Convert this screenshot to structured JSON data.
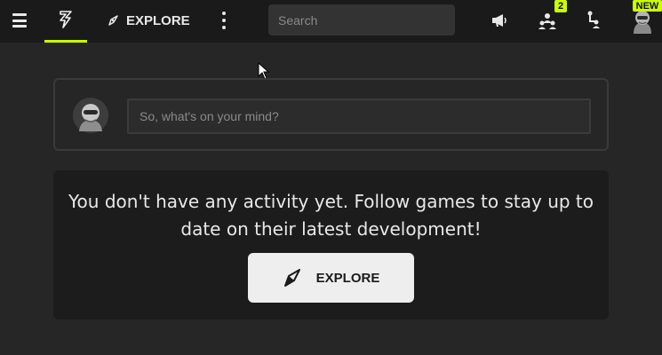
{
  "nav": {
    "explore_label": "EXPLORE",
    "search_placeholder": "Search",
    "notifications_badge": "2",
    "avatar_badge": "NEW"
  },
  "composer": {
    "placeholder": "So, what's on your mind?"
  },
  "feed": {
    "empty_message": "You don't have any activity yet. Follow games to stay up to date on their latest development!",
    "explore_button_label": "EXPLORE"
  },
  "colors": {
    "accent": "#ccff00",
    "background": "#262626",
    "topbar": "#1a1a1a",
    "card": "#1c1c1c",
    "button": "#eeeeee"
  },
  "icons": {
    "menu": "hamburger-menu-icon",
    "activity": "lightning-bolt-icon",
    "explore": "compass-icon",
    "more": "vertical-dots-icon",
    "announcements": "megaphone-icon",
    "friends": "user-group-icon",
    "network": "org-chart-icon",
    "cursor": "mouse-pointer-icon"
  }
}
